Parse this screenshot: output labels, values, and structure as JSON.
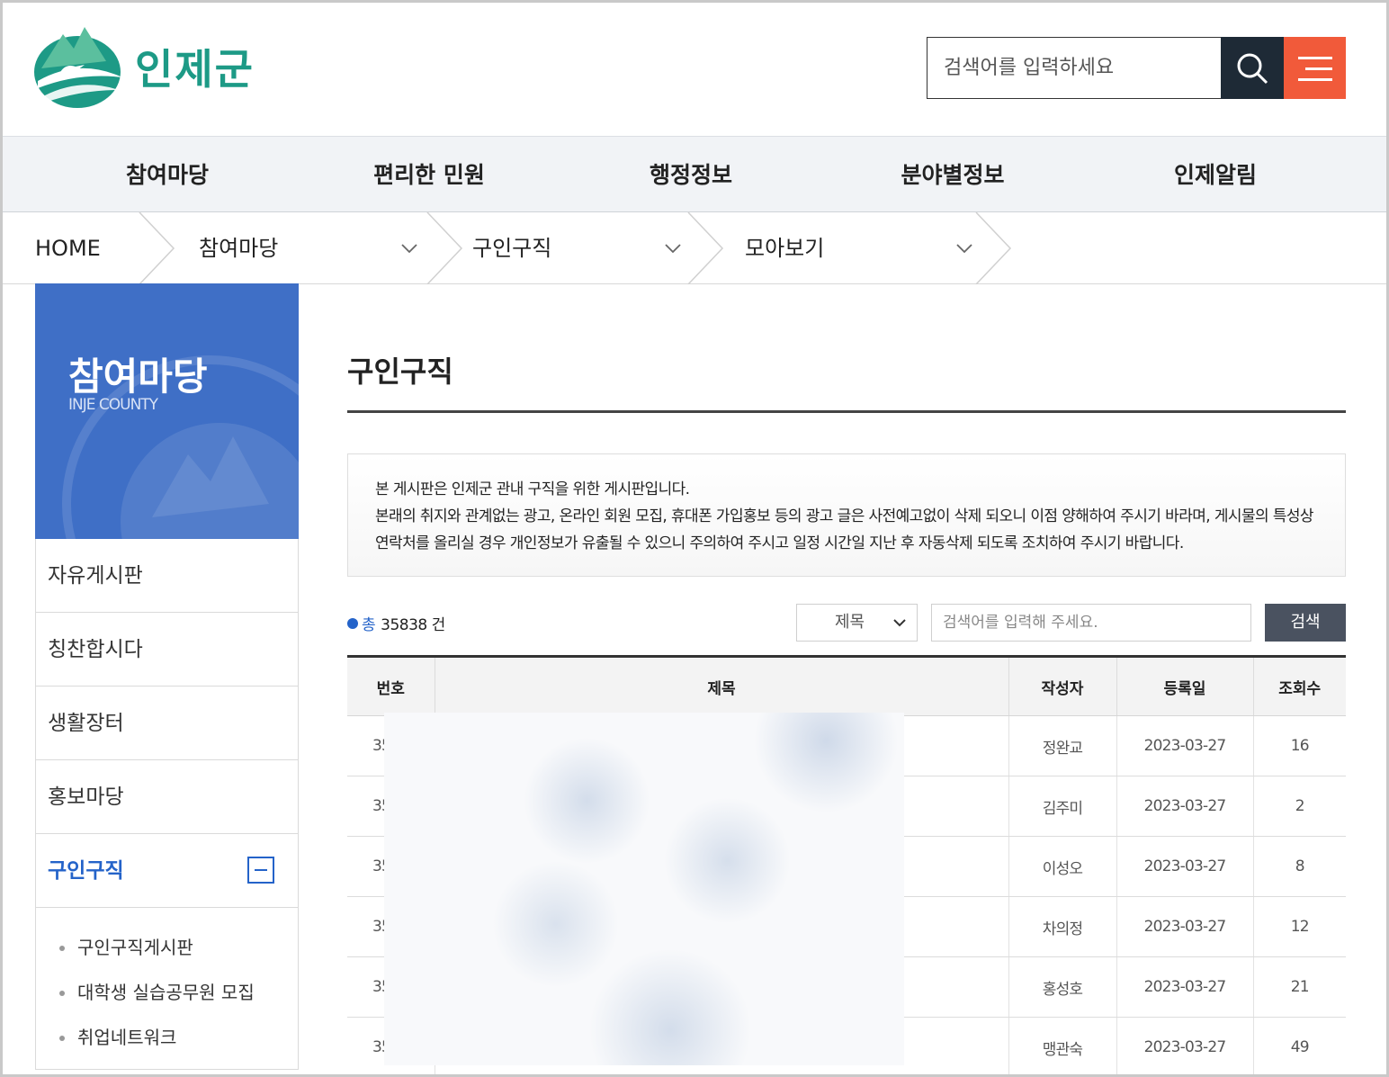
{
  "header": {
    "logo_text": "인제군",
    "search_placeholder": "검색어를 입력하세요"
  },
  "gnb": [
    "참여마당",
    "편리한 민원",
    "행정정보",
    "분야별정보",
    "인제알림"
  ],
  "breadcrumb": {
    "home": "HOME",
    "level1": "참여마당",
    "level2": "구인구직",
    "level3": "모아보기"
  },
  "sidebar": {
    "title": "참여마당",
    "subtitle": "INJE COUNTY",
    "items": [
      "자유게시판",
      "칭찬합시다",
      "생활장터",
      "홍보마당",
      "구인구직"
    ],
    "sub_items": [
      "구인구직게시판",
      "대학생 실습공무원 모집",
      "취업네트워크"
    ]
  },
  "content": {
    "title": "구인구직",
    "notice_line1": "본 게시판은 인제군 관내 구직을 위한 게시판입니다.",
    "notice_line2": "본래의 취지와 관계없는 광고, 온라인 회원 모집, 휴대폰 가입홍보 등의 광고 글은 사전예고없이 삭제 되오니 이점 양해하여 주시기 바라며, 게시물의 특성상 연락처를 올리실 경우 개인정보가 유출될 수 있으니 주의하여 주시고 일정 시간일 지난 후 자동삭제 되도록 조치하여 주시기 바랍니다.",
    "total_label": "총",
    "total_count": "35838 건",
    "select_value": "제목",
    "keyword_placeholder": "검색어를 입력해 주세요.",
    "search_button": "검색"
  },
  "table": {
    "headers": [
      "번호",
      "제목",
      "작성자",
      "등록일",
      "조회수"
    ],
    "rows": [
      {
        "num": "35",
        "subject": "",
        "author": "정완교",
        "date": "2023-03-27",
        "views": "16"
      },
      {
        "num": "35",
        "subject": "",
        "author": "김주미",
        "date": "2023-03-27",
        "views": "2"
      },
      {
        "num": "35",
        "subject": "",
        "author": "이성오",
        "date": "2023-03-27",
        "views": "8"
      },
      {
        "num": "35",
        "subject": "",
        "author": "차의정",
        "date": "2023-03-27",
        "views": "12"
      },
      {
        "num": "35",
        "subject": "",
        "author": "홍성호",
        "date": "2023-03-27",
        "views": "21"
      },
      {
        "num": "35",
        "subject": "",
        "author": "맹관숙",
        "date": "2023-03-27",
        "views": "49"
      }
    ]
  },
  "colors": {
    "brand_green": "#1d9a86",
    "accent_orange": "#f15a3a",
    "sidebar_blue": "#3f6fc6",
    "active_blue": "#2463c9"
  }
}
